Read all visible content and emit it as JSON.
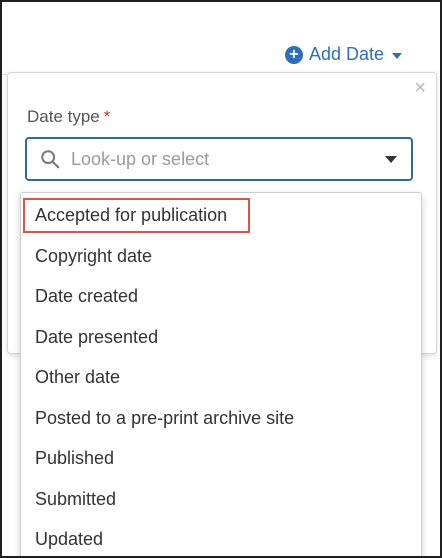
{
  "header": {
    "add_date_label": "Add Date",
    "add_icon": "plus-circle-icon",
    "caret_icon": "caret-down-icon"
  },
  "popover": {
    "close_symbol": "×"
  },
  "field": {
    "label": "Date type",
    "required_marker": "*",
    "placeholder": "Look-up or select",
    "search_icon": "search-icon"
  },
  "dropdown": {
    "options": [
      "Accepted for publication",
      "Copyright date",
      "Date created",
      "Date presented",
      "Other date",
      "Posted to a pre-print archive site",
      "Published",
      "Submitted",
      "Updated"
    ],
    "highlighted_index": 0
  },
  "colors": {
    "accent": "#2f6fb7",
    "focus_border": "#2e6f86",
    "highlight": "#d9534f",
    "required": "#c0392b"
  }
}
